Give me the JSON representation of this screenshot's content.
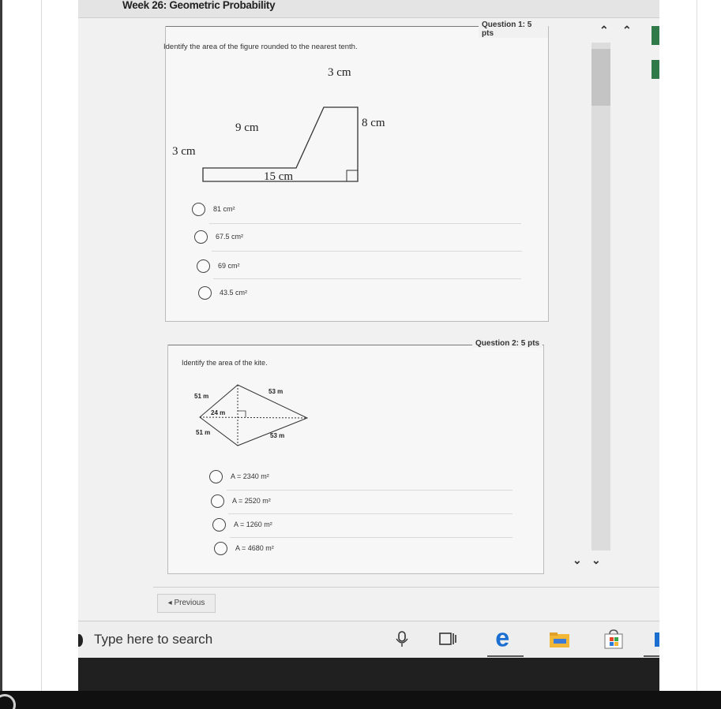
{
  "page": {
    "title": "Week 26: Geometric Probability"
  },
  "questions": [
    {
      "points": "Question 1: 5 pts",
      "prompt": "Identify the area of the figure rounded to the nearest tenth.",
      "figure_labels": {
        "top": "3 cm",
        "upper_left": "9 cm",
        "right": "8 cm",
        "left": "3 cm",
        "bottom": "15 cm"
      },
      "answers": [
        {
          "text": "81 cm²"
        },
        {
          "text": "67.5 cm²"
        },
        {
          "text": "69 cm²"
        },
        {
          "text": "43.5 cm²"
        }
      ]
    },
    {
      "points": "Question 2: 5 pts",
      "prompt": "Identify the area of the kite.",
      "figure_labels": {
        "upper_left": "51 m",
        "upper_right": "53 m",
        "middle": "24 m",
        "lower_left": "51 m",
        "lower_right": "53 m"
      },
      "answers": [
        {
          "text": "A = 2340 m²"
        },
        {
          "text": "A = 2520 m²"
        },
        {
          "text": "A = 1260 m²"
        },
        {
          "text": "A = 4680 m²"
        }
      ]
    }
  ],
  "navigation": {
    "previous": "◂ Previous"
  },
  "taskbar": {
    "search_placeholder": "Type here to search",
    "icons": [
      "microphone-icon",
      "task-view-icon",
      "edge-browser-icon",
      "file-explorer-icon",
      "store-icon"
    ]
  },
  "colors": {
    "edge_blue": "#1a6fd1",
    "explorer_yellow": "#f2b736",
    "store_red": "#e24a2a",
    "store_green": "#3aa64a",
    "green_accent": "#2f7a48"
  }
}
